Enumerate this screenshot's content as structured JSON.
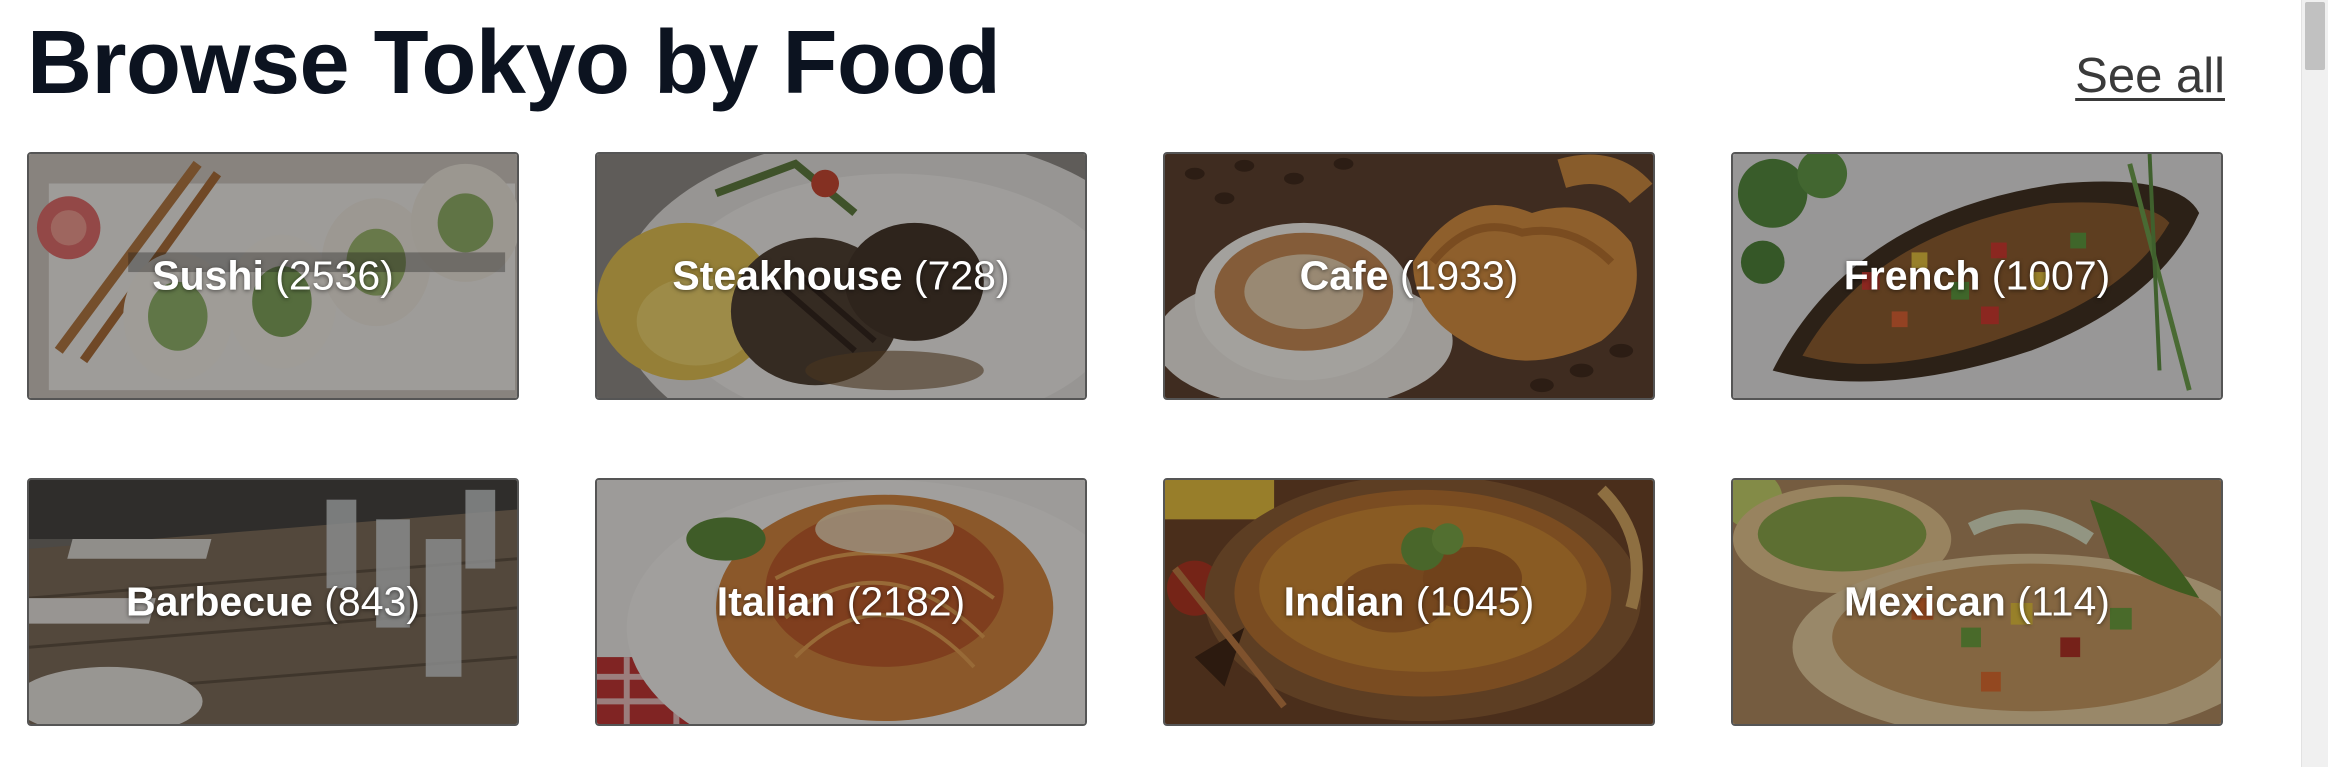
{
  "header": {
    "title": "Browse Tokyo by Food",
    "see_all": "See all"
  },
  "categories": [
    {
      "name": "Sushi",
      "count": "(2536)",
      "icon": "sushi-photo"
    },
    {
      "name": "Steakhouse",
      "count": "(728)",
      "icon": "steak-photo"
    },
    {
      "name": "Cafe",
      "count": "(1933)",
      "icon": "coffee-photo"
    },
    {
      "name": "French",
      "count": "(1007)",
      "icon": "french-dish-photo"
    },
    {
      "name": "Barbecue",
      "count": "(843)",
      "icon": "table-setting-photo"
    },
    {
      "name": "Italian",
      "count": "(2182)",
      "icon": "spaghetti-photo"
    },
    {
      "name": "Indian",
      "count": "(1045)",
      "icon": "curry-photo"
    },
    {
      "name": "Mexican",
      "count": "(114)",
      "icon": "tacos-photo"
    }
  ],
  "colors": {
    "title": "#0c1320",
    "link": "#3a3a3a",
    "overlay_text": "#ffffff"
  }
}
